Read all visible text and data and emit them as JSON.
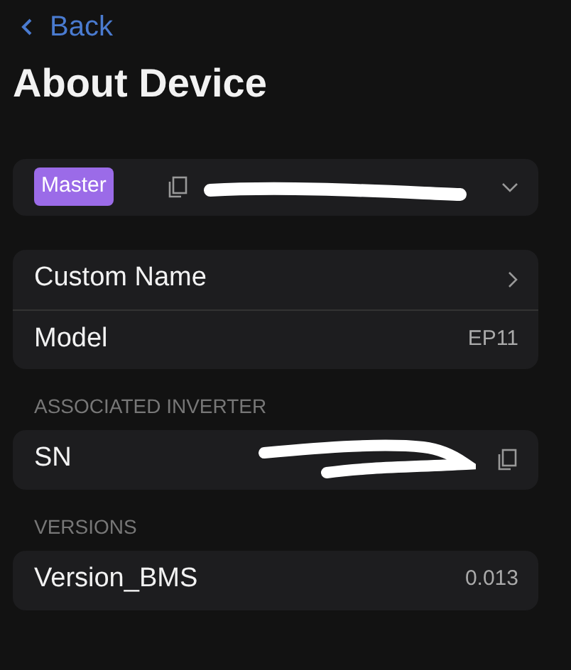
{
  "header": {
    "back": "Back",
    "title": "About Device"
  },
  "device": {
    "badge": "Master",
    "redacted": true
  },
  "groups": [
    {
      "rows": [
        {
          "kind": "link",
          "label": "Custom Name"
        },
        {
          "kind": "value",
          "label": "Model",
          "value": "EP11"
        }
      ]
    },
    {
      "heading": "ASSOCIATED INVERTER",
      "rows": [
        {
          "kind": "copy",
          "label": "SN",
          "redacted": true
        }
      ]
    },
    {
      "heading": "VERSIONS",
      "rows": [
        {
          "kind": "value",
          "label": "Version_BMS",
          "value": "0.013"
        }
      ]
    }
  ]
}
